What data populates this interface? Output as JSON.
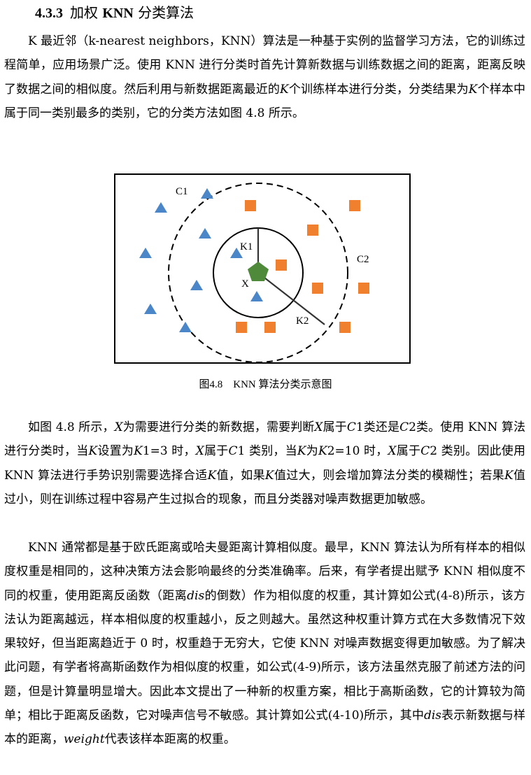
{
  "heading": {
    "number": "4.3.3",
    "prefix": "加权",
    "bold": "KNN",
    "suffix": "分类算法"
  },
  "paragraph1": {
    "p1": "K 最近邻（k-nearest neighbors，KNN）算法是一种基于实例的监督学习方法，它的训练过程简单，应用场景广泛。使用 KNN 进行分类时首先计算新数据与训练数据之间的距离，距离反映了数据之间的相似度。然后利用与新数据距离最近的",
    "k1": "K",
    "p2": "个训练样本进行分类，分类结果为",
    "k2": "K",
    "p3": "个样本中属于同一类别最多的类别，它的分类方法如图 4.8 所示。"
  },
  "figure": {
    "labels": {
      "c1": "C1",
      "c2": "C2",
      "k1": "K1",
      "k2": "K2",
      "x": "X"
    },
    "colors": {
      "triangle": "#4a86c8",
      "square": "#f07f2e",
      "pentagon": "#4e8a3a"
    },
    "caption": "图4.8　KNN 算法分类示意图"
  },
  "paragraph2": {
    "a": "如图 4.8 所示，",
    "x1": "X",
    "b": "为需要进行分类的新数据，需要判断",
    "x2": "X",
    "c": "属于",
    "c1a": "C",
    "c1b": "1",
    "d": "类还是",
    "c2a": "C",
    "c2b": "2",
    "e": "类。使用 KNN 算法进行分类时，当",
    "k1": "K",
    "f": "设置为",
    "k1b": "K",
    "g": "1=3 时，",
    "x3": "X",
    "h": "属于",
    "c1c": "C",
    "i": "1 类别，当",
    "k2": "K",
    "j": "为",
    "k2b": "K",
    "k": "2=10 时，",
    "x4": "X",
    "l": "属于",
    "c2c": "C",
    "m": "2 类别。因此使用 KNN 算法进行手势识别需要选择合适",
    "k3": "K",
    "n": "值，如果",
    "k4": "K",
    "o": "值过大，则会增加算法分类的模糊性；若果",
    "k5": "K",
    "p": "值过小，则在训练过程中容易产生过拟合的现象，而且分类器对噪声数据更加敏感。"
  },
  "paragraph3": {
    "a": "KNN 通常都是基于欧氏距离或哈夫曼距离计算相似度。最早，KNN 算法认为所有样本的相似度权重是相同的，这种决策方法会影响最终的分类准确率。后来，有学者提出赋予 KNN 相似度不同的权重，使用距离反函数（距离",
    "dis1": "dis",
    "b": "的倒数）作为相似度的权重，其计算如公式(4-8)所示，该方法认为距离越远，样本相似度的权重越小，反之则越大。虽然这种权重计算方式在大多数情况下效果较好，但当距离趋近于 0 时，权重趋于无穷大，它使 KNN 对噪声数据变得更加敏感。为了解决此问题，有学者将高斯函数作为相似度的权重，如公式(4-9)所示，该方法虽然克服了前述方法的问题，但是计算量明显增大。因此本文提出了一种新的权重方案，相比于高斯函数，它的计算较为简单；相比于距离反函数，它对噪声信号不敏感。其计算如公式(4-10)所示，其中",
    "dis2": "dis",
    "c": "表示新数据与样本的距离，",
    "weight": "weight",
    "d": "代表该样本距离的权重。"
  }
}
